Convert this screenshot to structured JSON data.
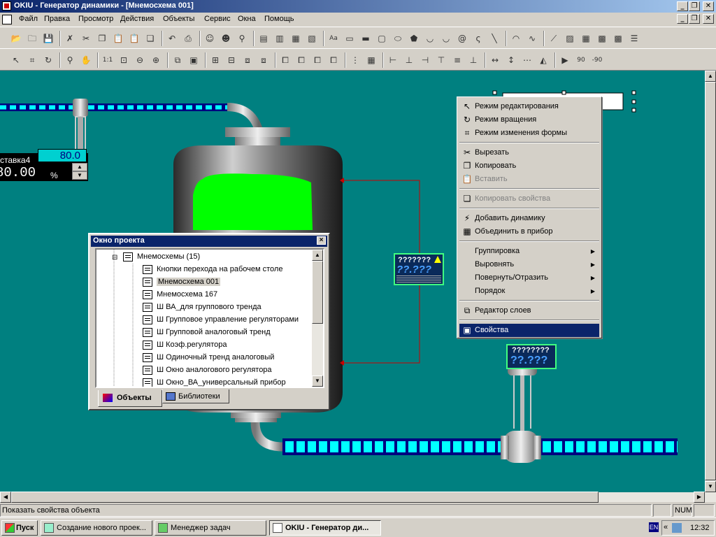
{
  "window": {
    "title": "OKIU - Генератор динамики - [Мнемосхема 001]",
    "controls": [
      "_",
      "❐",
      "✕"
    ],
    "mdi_controls": [
      "_",
      "❐",
      "✕"
    ]
  },
  "menu": [
    "Файл",
    "Правка",
    "Просмотр",
    "Действия",
    "Объекты",
    "Сервис",
    "Окна",
    "Помощь"
  ],
  "toolbar1_icons": [
    "open-icon",
    "folder-icon",
    "save-icon",
    "cut-red-icon",
    "cut-icon",
    "copy-icon",
    "paste-icon",
    "paste-special-icon",
    "copy-props-icon",
    "undo-icon",
    "print-icon",
    "person-icon",
    "person2-icon",
    "binoculars-icon",
    "window1-icon",
    "window2-icon",
    "window3-icon",
    "window4-icon",
    "text-icon",
    "rect-icon",
    "rect2-icon",
    "round-rect-icon",
    "ellipse-icon",
    "polygon-icon",
    "shape-icon",
    "shape2-icon",
    "spiral-icon",
    "polyline-icon",
    "line-icon",
    "arc-icon",
    "bezier-icon",
    "trend-icon",
    "chart-icon",
    "table-icon",
    "grid-icon",
    "grid2-icon",
    "list-icon"
  ],
  "toolbar2_icons": [
    "pointer-icon",
    "edit-shape-icon",
    "rotate-icon",
    "zoom-icon",
    "hand-icon",
    "zoom-1to1-icon",
    "zoom-fit-icon",
    "zoom-out-icon",
    "zoom-in-icon",
    "layers-icon",
    "properties-icon",
    "group-icon",
    "ungroup-icon",
    "combine-icon",
    "combine2-icon",
    "front-icon",
    "back-icon",
    "forward-icon",
    "backward-icon",
    "grid-snap-icon",
    "grid-show-icon",
    "align-left-icon",
    "align-center-icon",
    "align-right-icon",
    "align-top-icon",
    "align-middle-icon",
    "align-bottom-icon",
    "same-width-icon",
    "same-height-icon",
    "distribute-icon",
    "flip-h-icon",
    "flip-v-icon",
    "rotate90-icon",
    "rotate-90-icon"
  ],
  "canvas": {
    "bg_color": "#008080",
    "setpoint_label": "ставка4",
    "setpoint_value": "80.0",
    "output_value": "80.00",
    "output_unit": "%",
    "device1_label": "???????",
    "device1_value": "??.???",
    "device2_label": "????????",
    "device2_value": "??.???"
  },
  "project_window": {
    "title": "Окно проекта",
    "close": "×",
    "root": "Мнемосхемы (15)",
    "items": [
      "Кнопки перехода на рабочем столе",
      "Мнемосхема 001",
      "Мнемосхема 167",
      "Ш ВА_для группового тренда",
      "Ш Групповое управление регуляторами",
      "Ш Групповой аналоговый тренд",
      "Ш Коэф.регулятора",
      "Ш Одиночный тренд аналоговый",
      "Ш Окно аналогового регулятора",
      "Ш Окно_ВА_универсальный прибор"
    ],
    "selected_index": 1,
    "tabs": [
      "Объекты",
      "Библиотеки"
    ],
    "active_tab": 0
  },
  "context_menu": {
    "items": [
      {
        "label": "Режим редактирования",
        "icon": "pointer-icon",
        "enabled": true
      },
      {
        "label": "Режим вращения",
        "icon": "rotate-icon",
        "enabled": true
      },
      {
        "label": "Режим изменения формы",
        "icon": "edit-shape-icon",
        "enabled": true
      },
      {
        "sep": true
      },
      {
        "label": "Вырезать",
        "icon": "cut-icon",
        "enabled": true
      },
      {
        "label": "Копировать",
        "icon": "copy-icon",
        "enabled": true
      },
      {
        "label": "Вставить",
        "icon": "paste-icon",
        "enabled": false
      },
      {
        "sep": true
      },
      {
        "label": "Копировать свойства",
        "icon": "copy-props-icon",
        "enabled": false
      },
      {
        "sep": true
      },
      {
        "label": "Добавить динамику",
        "icon": "dynamics-icon",
        "enabled": true
      },
      {
        "label": "Объединить в прибор",
        "icon": "device-icon",
        "enabled": true
      },
      {
        "sep": true
      },
      {
        "label": "Группировка",
        "submenu": true,
        "enabled": true
      },
      {
        "label": "Выровнять",
        "submenu": true,
        "enabled": true
      },
      {
        "label": "Повернуть/Отразить",
        "submenu": true,
        "enabled": true
      },
      {
        "label": "Порядок",
        "submenu": true,
        "enabled": true
      },
      {
        "sep": true
      },
      {
        "label": "Редактор слоев",
        "icon": "layers-icon",
        "enabled": true
      },
      {
        "sep": true
      },
      {
        "label": "Свойства",
        "icon": "properties-icon",
        "enabled": true,
        "selected": true
      }
    ]
  },
  "statusbar": {
    "text": "Показать свойства объекта",
    "num": "NUM"
  },
  "taskbar": {
    "start": "Пуск",
    "tasks": [
      "Создание нового проек...",
      "Менеджер задач",
      "OKIU - Генератор ди..."
    ],
    "active_task": 2,
    "lang": "EN",
    "time": "12:32"
  }
}
